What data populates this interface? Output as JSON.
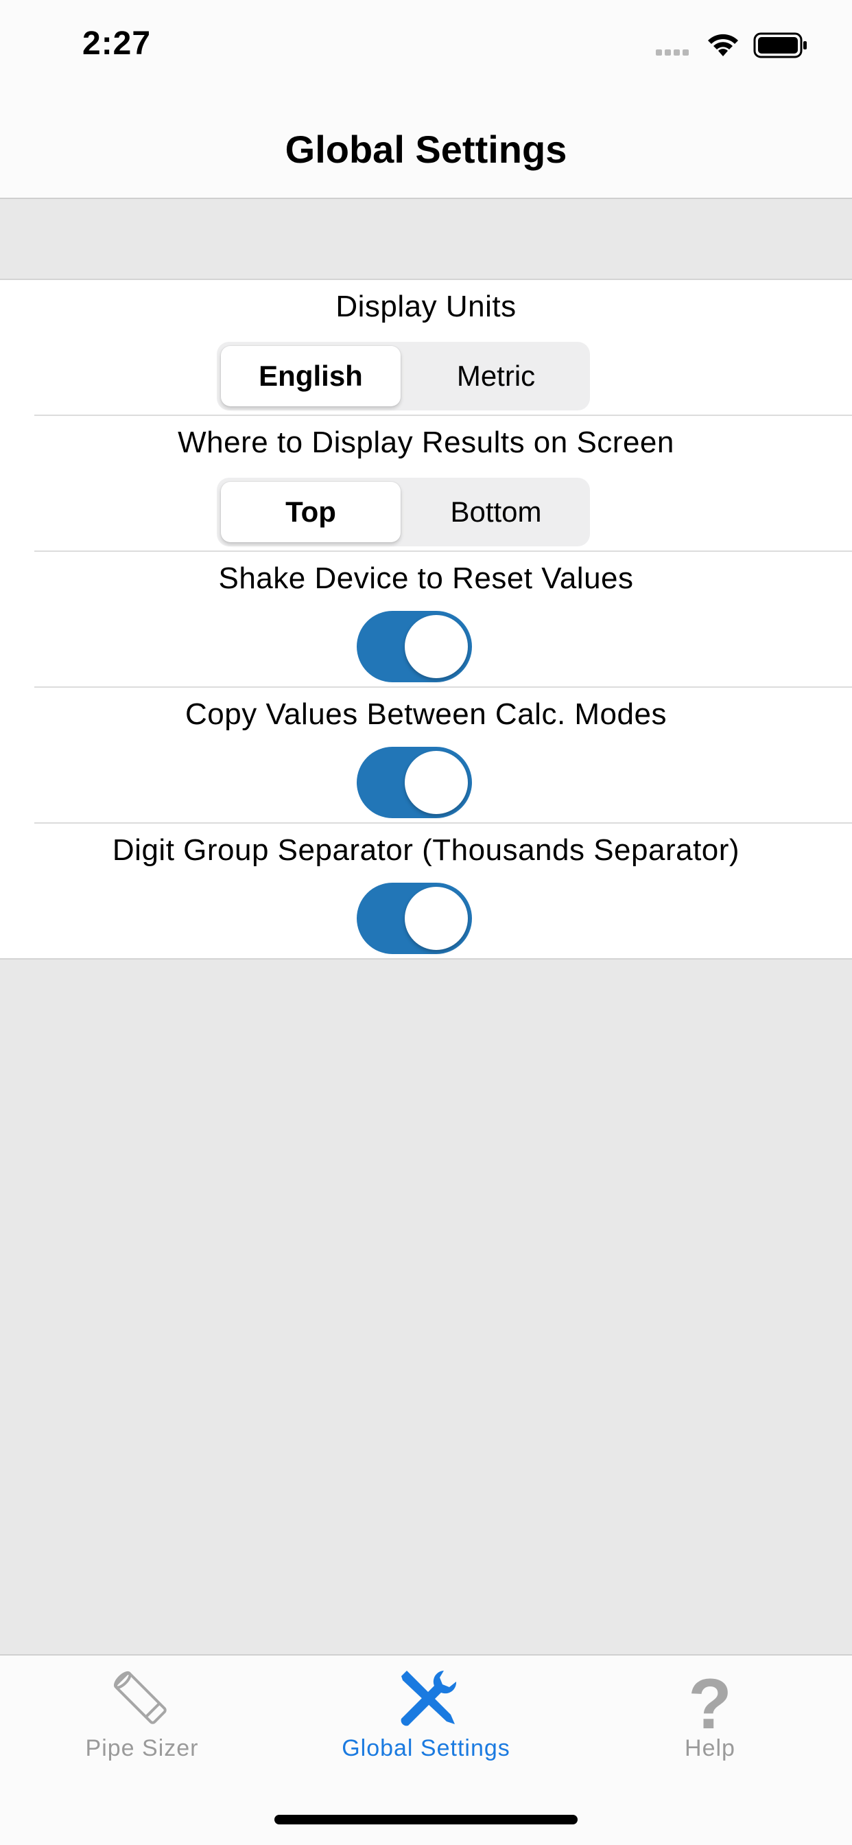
{
  "status_bar": {
    "time": "2:27",
    "signal_icon": "signal-dots-icon",
    "wifi_icon": "wifi-icon",
    "battery_icon": "battery-icon"
  },
  "nav": {
    "title": "Global Settings"
  },
  "settings": {
    "display_units": {
      "label": "Display Units",
      "options": [
        "English",
        "Metric"
      ],
      "selected": "English"
    },
    "results_position": {
      "label": "Where to Display Results on Screen",
      "options": [
        "Top",
        "Bottom"
      ],
      "selected": "Top"
    },
    "shake_reset": {
      "label": "Shake Device to Reset Values",
      "on": true
    },
    "copy_values": {
      "label": "Copy Values Between Calc. Modes",
      "on": true
    },
    "digit_separator": {
      "label": "Digit Group Separator (Thousands Separator)",
      "on": true
    }
  },
  "tab_bar": {
    "tabs": [
      {
        "label": "Pipe Sizer",
        "icon": "pipe-icon",
        "active": false
      },
      {
        "label": "Global Settings",
        "icon": "wrench-screwdriver-icon",
        "active": true
      },
      {
        "label": "Help",
        "icon": "question-mark-icon",
        "active": false
      }
    ]
  },
  "colors": {
    "accent": "#1a7ae0",
    "toggle_on": "#2276b7",
    "inactive_tab": "#9a9a9a",
    "background": "#e8e8e8"
  }
}
